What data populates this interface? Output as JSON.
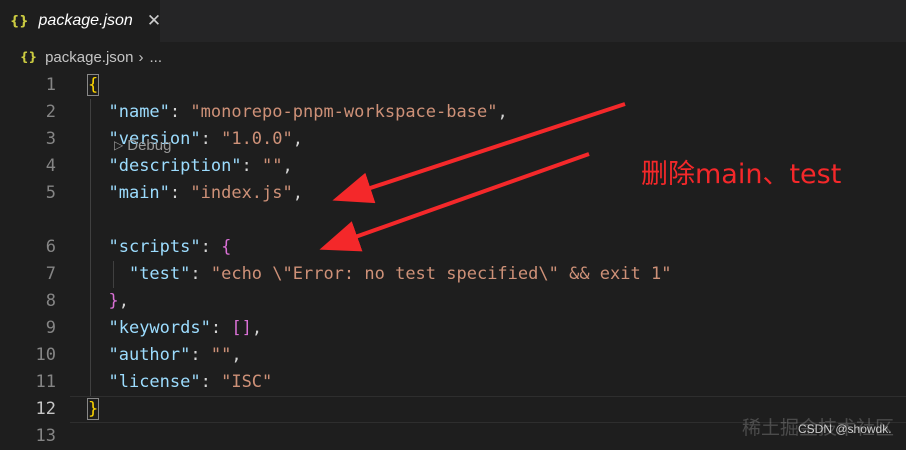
{
  "tab": {
    "icon": "json-braces-icon",
    "icon_glyph": "{}",
    "filename": "package.json",
    "close_glyph": "✕"
  },
  "breadcrumb": {
    "icon_glyph": "{}",
    "file": "package.json",
    "separator": "›",
    "more": "..."
  },
  "lines": [
    {
      "num": "1"
    },
    {
      "num": "2"
    },
    {
      "num": "3"
    },
    {
      "num": "4"
    },
    {
      "num": "5"
    },
    {
      "num": "6"
    },
    {
      "num": "7"
    },
    {
      "num": "8"
    },
    {
      "num": "9"
    },
    {
      "num": "10"
    },
    {
      "num": "11"
    },
    {
      "num": "12"
    },
    {
      "num": "13"
    }
  ],
  "code": {
    "open_brace": "{",
    "name_key": "\"name\"",
    "name_val": "\"monorepo-pnpm-workspace-base\"",
    "version_key": "\"version\"",
    "version_val": "\"1.0.0\"",
    "description_key": "\"description\"",
    "description_val": "\"\"",
    "main_key": "\"main\"",
    "main_val": "\"index.js\"",
    "scripts_key": "\"scripts\"",
    "scripts_open": "{",
    "test_key": "\"test\"",
    "test_val": "\"echo \\\"Error: no test specified\\\" && exit 1\"",
    "scripts_close": "}",
    "keywords_key": "\"keywords\"",
    "keywords_val": "[]",
    "author_key": "\"author\"",
    "author_val": "\"\"",
    "license_key": "\"license\"",
    "license_val": "\"ISC\"",
    "close_brace": "}",
    "colon": ": ",
    "comma": ","
  },
  "codelens": {
    "icon": "play-icon",
    "label": "Debug"
  },
  "annotation": {
    "text": "删除main、test",
    "color": "#f4282a"
  },
  "watermark": {
    "site": "稀土掘金技术社区",
    "credit": "CSDN @showdk."
  },
  "colors": {
    "background": "#1e1e1e",
    "key": "#9cdcfe",
    "string": "#ce9178",
    "bracket_level1": "#ffd700",
    "bracket_level2": "#da70d6"
  }
}
